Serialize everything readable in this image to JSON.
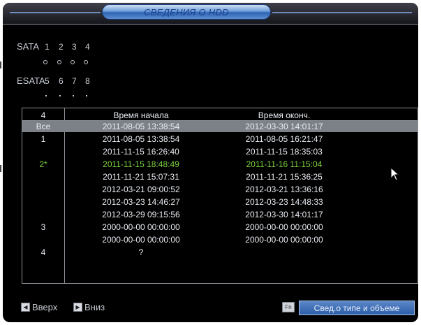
{
  "title": "СВЕДЕНИЯ О HDD",
  "sata": {
    "label": "SATA",
    "ports": [
      "1",
      "2",
      "3",
      "4"
    ]
  },
  "esata": {
    "label": "ESATA",
    "ports": [
      "5",
      "6",
      "7",
      "8"
    ]
  },
  "table": {
    "header": [
      "4",
      "Время начала",
      "Время оконч."
    ],
    "rows": [
      {
        "disk": "Все",
        "start": "2011-08-05 13:38:54",
        "end": "2012-03-30 14:01:17"
      },
      {
        "disk": "1",
        "start": "2011-08-05 13:38:54",
        "end": "2011-08-05 16:21:47"
      },
      {
        "disk": "",
        "start": "2011-11-15 16:26:40",
        "end": "2011-11-15 18:35:03"
      },
      {
        "disk": "2*",
        "start": "2011-11-15 18:48:49",
        "end": "2011-11-16 11:15:04"
      },
      {
        "disk": "",
        "start": "2011-11-21 15:07:31",
        "end": "2011-11-21 15:36:25"
      },
      {
        "disk": "",
        "start": "2012-03-21 09:00:52",
        "end": "2012-03-21 13:36:16"
      },
      {
        "disk": "",
        "start": "2012-03-23 14:46:27",
        "end": "2012-03-23 14:48:33"
      },
      {
        "disk": "",
        "start": "2012-03-29 09:15:56",
        "end": "2012-03-30 14:01:17"
      },
      {
        "disk": "3",
        "start": "2000-00-00 00:00:00",
        "end": "2000-00-00 00:00:00"
      },
      {
        "disk": "",
        "start": "2000-00-00 00:00:00",
        "end": "2000-00-00 00:00:00"
      },
      {
        "disk": "4",
        "start": "?",
        "end": ""
      }
    ]
  },
  "footer": {
    "up_label": "Вверх",
    "down_label": "Вниз",
    "fn_key": "Fn",
    "info_button": "Свед.о типе и объеме"
  },
  "colors": {
    "highlight_row": "#7c8087",
    "active_text": "#7bd13e",
    "title_accent": "#2f64b5"
  }
}
